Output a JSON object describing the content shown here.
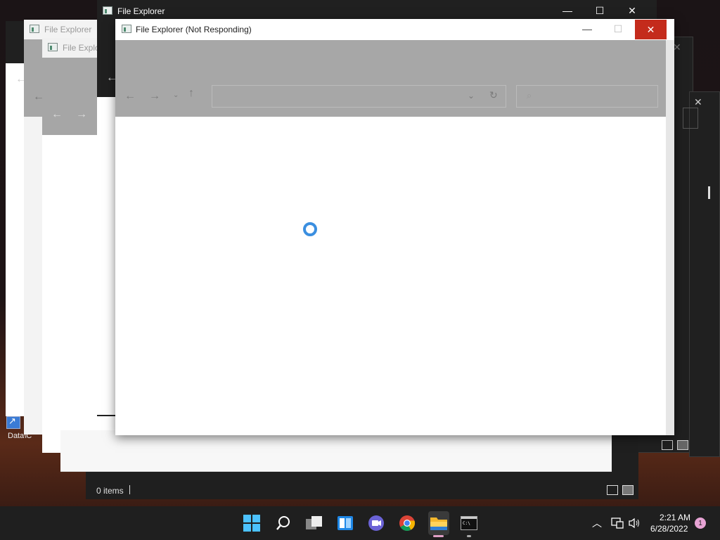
{
  "windows": {
    "back_far_title": "File Explorer",
    "back_mid_title": "File Explo",
    "main_title": "File Explorer",
    "front_title": "File Explorer (Not Responding)"
  },
  "desktop": {
    "shortcut_label": "Data\\C"
  },
  "statusbar": {
    "items": "0 items"
  },
  "tray": {
    "time": "2:21 AM",
    "date": "6/28/2022",
    "notification_count": "1"
  },
  "colors": {
    "accent": "#1e87e6",
    "close_red": "#c42b1c",
    "spinner": "#3b8fe0"
  }
}
